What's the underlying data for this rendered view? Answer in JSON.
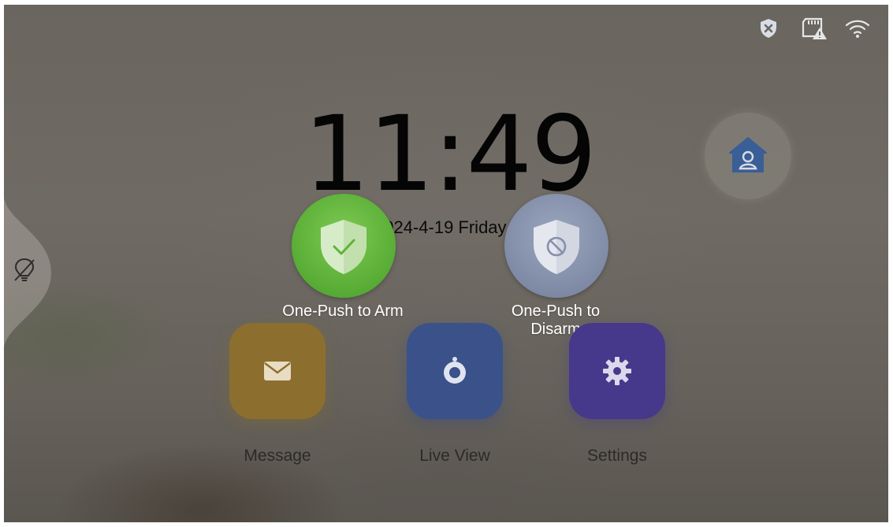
{
  "status_bar": {
    "icons": [
      "shield-x-icon",
      "sd-card-warning-icon",
      "wifi-icon"
    ]
  },
  "clock": {
    "time": "11:49",
    "date": "2024-4-19  Friday"
  },
  "home_button": {
    "icon": "home-user-icon"
  },
  "side_tab": {
    "icon": "bulb-off-icon"
  },
  "arm": {
    "label": "One-Push to Arm",
    "icon": "shield-check-icon",
    "color": "#5fb23a"
  },
  "disarm": {
    "label_line1": "One-Push to",
    "label_line2": "Disarm",
    "icon": "shield-disabled-icon",
    "color": "#8590ab"
  },
  "apps": [
    {
      "label": "Message",
      "icon": "envelope-icon",
      "color": "#8c6f2f"
    },
    {
      "label": "Live View",
      "icon": "camera-icon",
      "color": "#3a5189"
    },
    {
      "label": "Settings",
      "icon": "gear-icon",
      "color": "#46388a"
    }
  ]
}
